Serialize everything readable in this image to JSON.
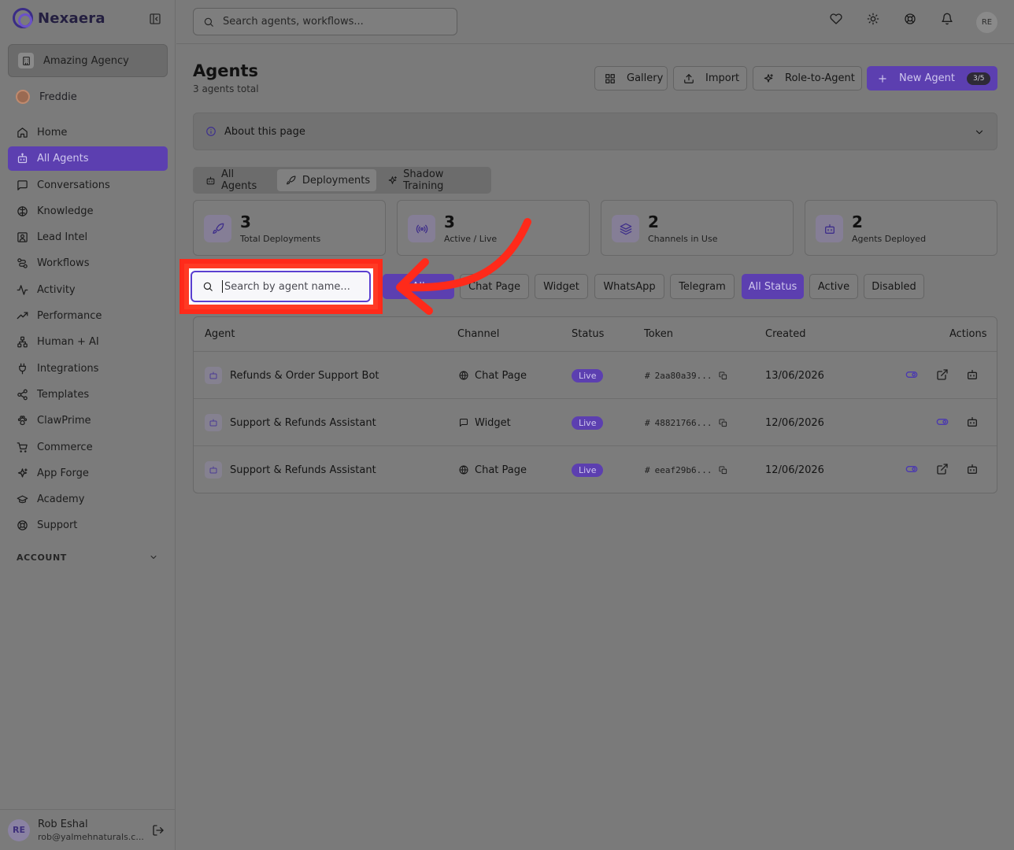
{
  "brand": {
    "name": "Nexaera"
  },
  "sidebar": {
    "org": "Amazing Agency",
    "user": "Freddie",
    "items": [
      {
        "label": "Home",
        "icon": "home-icon"
      },
      {
        "label": "All Agents",
        "icon": "bot-icon",
        "active": true
      },
      {
        "label": "Conversations",
        "icon": "chat-icon"
      },
      {
        "label": "Knowledge",
        "icon": "brain-icon"
      },
      {
        "label": "Lead Intel",
        "icon": "contact-icon"
      },
      {
        "label": "Workflows",
        "icon": "workflow-icon"
      },
      {
        "label": "Activity",
        "icon": "activity-icon"
      },
      {
        "label": "Performance",
        "icon": "trending-icon"
      },
      {
        "label": "Human + AI",
        "icon": "network-icon"
      },
      {
        "label": "Integrations",
        "icon": "plug-icon"
      },
      {
        "label": "Templates",
        "icon": "share-icon"
      },
      {
        "label": "ClawPrime",
        "icon": "paw-icon"
      },
      {
        "label": "Commerce",
        "icon": "cart-icon"
      },
      {
        "label": "App Forge",
        "icon": "sparkles-icon"
      },
      {
        "label": "Academy",
        "icon": "graduation-icon"
      },
      {
        "label": "Support",
        "icon": "lifebuoy-icon"
      }
    ],
    "account_label": "ACCOUNT",
    "footer": {
      "initials": "RE",
      "name": "Rob Eshal",
      "email": "rob@yalmehnaturals.c..."
    }
  },
  "topbar": {
    "search_placeholder": "Search agents, workflows...",
    "avatar": "RE"
  },
  "header": {
    "title": "Agents",
    "subtitle": "3 agents total",
    "buttons": {
      "gallery": "Gallery",
      "import": "Import",
      "role": "Role-to-Agent",
      "new_agent": "New Agent",
      "count": "3/5"
    }
  },
  "about": {
    "label": "About this page"
  },
  "tabs": [
    {
      "label": "All Agents"
    },
    {
      "label": "Deployments",
      "active": true
    },
    {
      "label": "Shadow Training"
    }
  ],
  "stats": [
    {
      "value": "3",
      "label": "Total Deployments",
      "icon": "rocket-icon"
    },
    {
      "value": "3",
      "label": "Active / Live",
      "icon": "radio-icon"
    },
    {
      "value": "2",
      "label": "Channels in Use",
      "icon": "layers-icon"
    },
    {
      "value": "2",
      "label": "Agents Deployed",
      "icon": "bot-icon"
    }
  ],
  "filters": {
    "search_placeholder": "Search by agent name...",
    "channel": [
      "All",
      "Chat Page",
      "Widget",
      "WhatsApp",
      "Telegram"
    ],
    "status": [
      "All Status",
      "Active",
      "Disabled"
    ]
  },
  "table": {
    "headers": {
      "agent": "Agent",
      "channel": "Channel",
      "status": "Status",
      "token": "Token",
      "created": "Created",
      "actions": "Actions"
    },
    "rows": [
      {
        "agent": "Refunds & Order Support Bot",
        "channel": "Chat Page",
        "status": "Live",
        "token": "2aa80a39...",
        "created": "13/06/2026"
      },
      {
        "agent": "Support & Refunds Assistant",
        "channel": "Widget",
        "status": "Live",
        "token": "48821766...",
        "created": "12/06/2026"
      },
      {
        "agent": "Support & Refunds Assistant",
        "channel": "Chat Page",
        "status": "Live",
        "token": "eeaf29b6...",
        "created": "12/06/2026"
      }
    ]
  },
  "colors": {
    "accent": "#5c3fb0",
    "annotation": "#ff2a1a",
    "overlay": "#7a7a7a"
  }
}
